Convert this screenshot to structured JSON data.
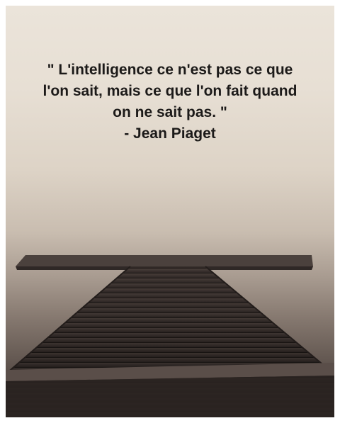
{
  "quote": {
    "lines": [
      "\" L'intelligence ce n'est pas ce que",
      "l'on sait, mais ce que l'on fait quand",
      "on ne sait pas. \"",
      "- Jean Piaget"
    ]
  },
  "colors": {
    "text": "#1c1a19",
    "sky_top": "#ebe4da",
    "sky_bottom": "#3a322f",
    "pier": "#2e2624"
  }
}
